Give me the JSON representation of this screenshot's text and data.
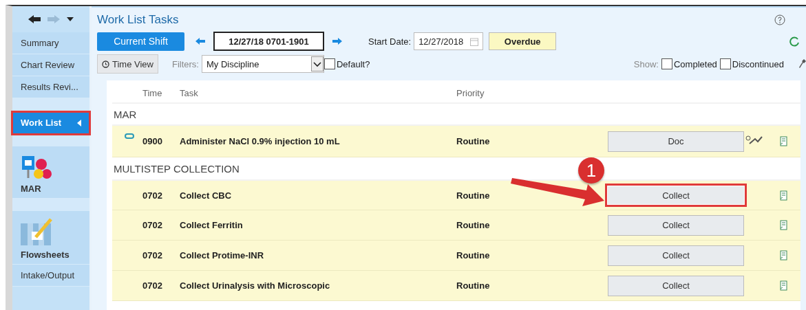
{
  "sidebar": {
    "items": [
      {
        "kind": "text",
        "label": "Summary",
        "selected": false,
        "highlighted": false
      },
      {
        "kind": "text",
        "label": "Chart Review",
        "selected": false,
        "highlighted": false
      },
      {
        "kind": "text",
        "label": "Results Revi...",
        "selected": false,
        "highlighted": false
      },
      {
        "kind": "spacer"
      },
      {
        "kind": "text",
        "label": "Work List",
        "selected": true,
        "highlighted": true
      },
      {
        "kind": "spacer"
      },
      {
        "kind": "medication",
        "label": "MAR",
        "selected": false,
        "highlighted": false
      },
      {
        "kind": "spacer"
      },
      {
        "kind": "chart",
        "label": "Flowsheets",
        "selected": false,
        "highlighted": false
      },
      {
        "kind": "text",
        "label": "Intake/Output",
        "selected": false,
        "highlighted": false
      }
    ]
  },
  "title": "Work List Tasks",
  "toolbar": {
    "current_shift": "Current Shift",
    "shift_range": "12/27/18 0701-1901",
    "start_date_label": "Start Date:",
    "start_date": "12/27/2018",
    "overdue": "Overdue",
    "time_view": "Time View",
    "filters_label": "Filters:",
    "filter": "My Discipline",
    "default_label": "Default?",
    "default_checked": false,
    "show_label": "Show:",
    "show_options": [
      {
        "label": "Completed",
        "checked": false
      },
      {
        "label": "Discontinued",
        "checked": false
      }
    ]
  },
  "table": {
    "columns": [
      "Time",
      "Task",
      "Priority"
    ],
    "sections": [
      {
        "name": "MAR",
        "rows": [
          {
            "linked": true,
            "time": "0900",
            "task": "Administer NaCl 0.9% injection 10 mL",
            "priority": "Routine",
            "action": "Doc",
            "highlighted": false,
            "extra_icon": true
          }
        ]
      },
      {
        "name": "MULTISTEP COLLECTION",
        "rows": [
          {
            "linked": false,
            "time": "0702",
            "task": "Collect CBC",
            "priority": "Routine",
            "action": "Collect",
            "highlighted": true,
            "extra_icon": false
          },
          {
            "linked": false,
            "time": "0702",
            "task": "Collect Ferritin",
            "priority": "Routine",
            "action": "Collect",
            "highlighted": false,
            "extra_icon": false
          },
          {
            "linked": false,
            "time": "0702",
            "task": "Collect Protime-INR",
            "priority": "Routine",
            "action": "Collect",
            "highlighted": false,
            "extra_icon": false
          },
          {
            "linked": false,
            "time": "0702",
            "task": "Collect Urinalysis with Microscopic",
            "priority": "Routine",
            "action": "Collect",
            "highlighted": false,
            "extra_icon": false
          }
        ]
      }
    ]
  },
  "callout": {
    "number": "1"
  }
}
